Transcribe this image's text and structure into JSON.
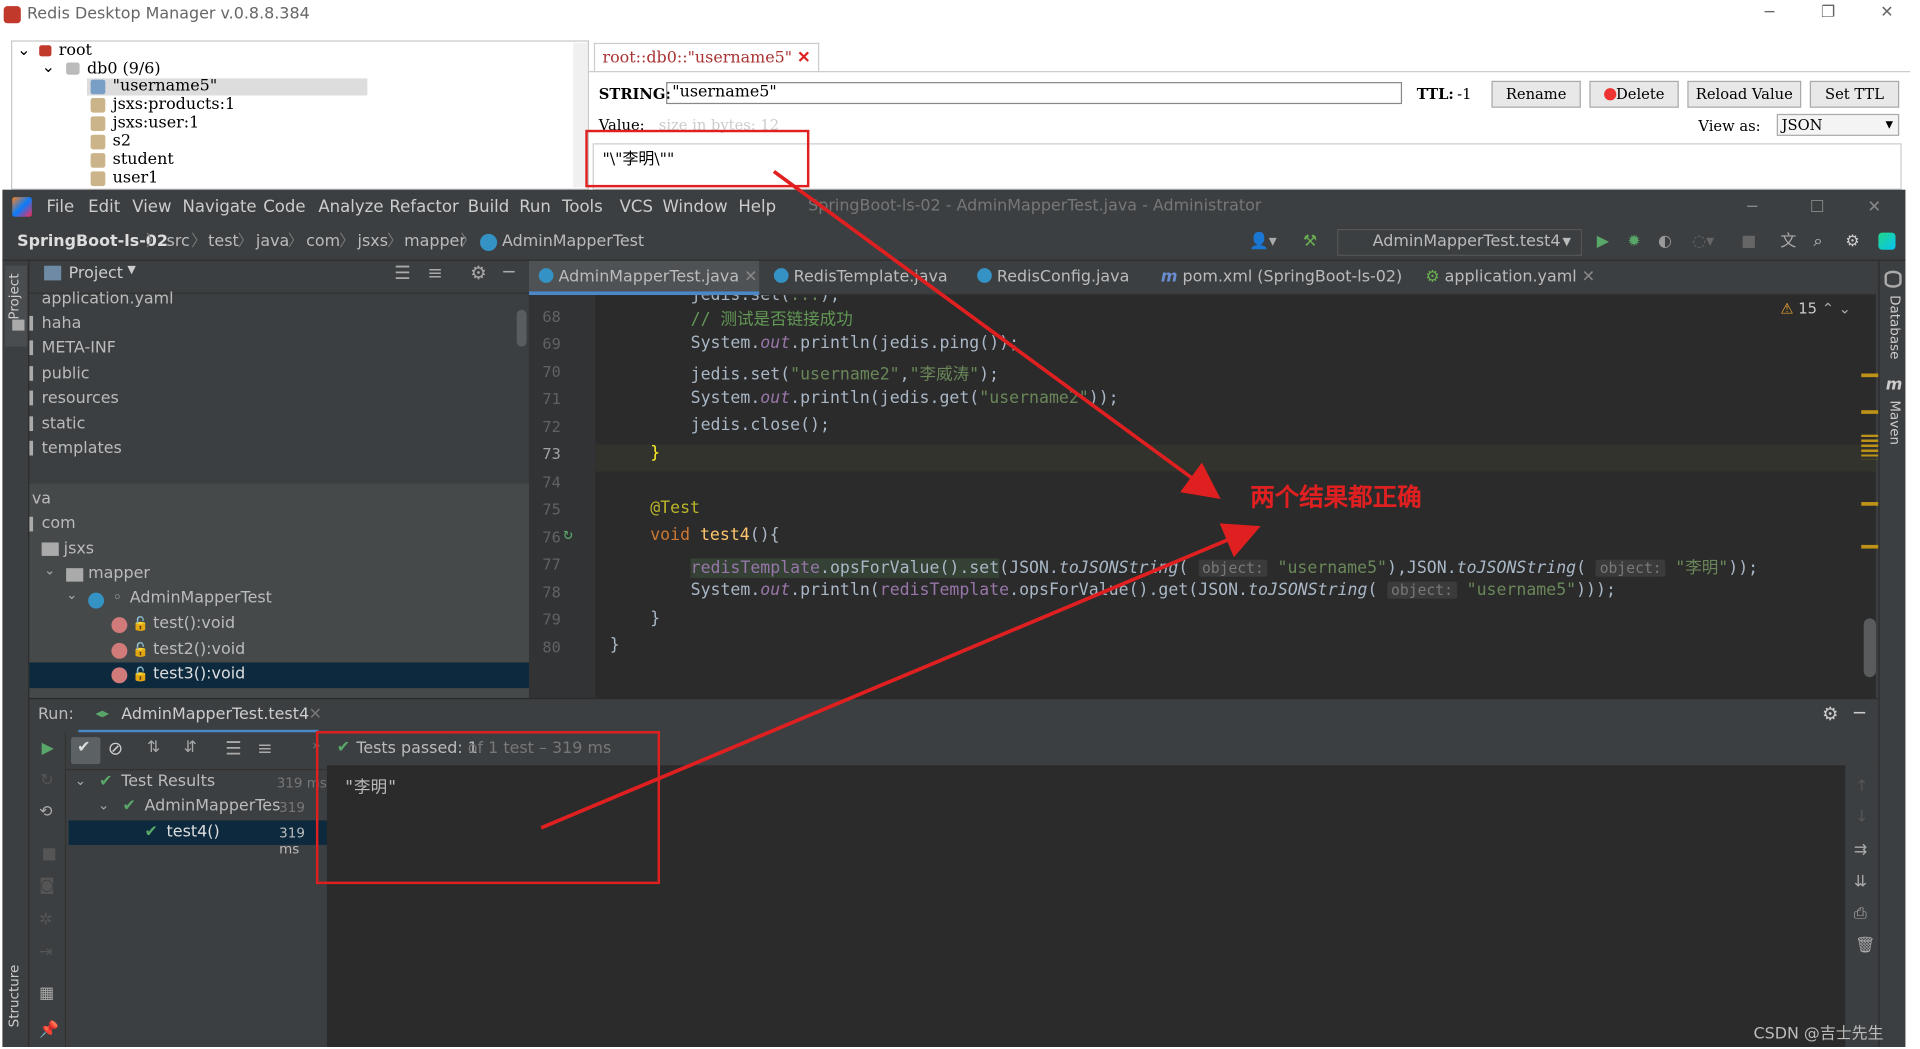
{
  "rdm": {
    "title": "Redis Desktop Manager v.0.8.8.384",
    "tree": {
      "root": "root",
      "db": "db0  (9/6)",
      "keys": [
        "\"username5\"",
        "jsxs:products:1",
        "jsxs:user:1",
        "s2",
        "student",
        "user1"
      ]
    },
    "tab_title": "root::db0::\"username5\"",
    "key_type": "STRING:",
    "key_value": "\"username5\"",
    "ttl_label": "TTL:",
    "ttl_value": "-1",
    "buttons": {
      "rename": "Rename",
      "delete": "Delete",
      "reload": "Reload Value",
      "set_ttl": "Set TTL"
    },
    "value_label": "Value:",
    "value_size": "size in bytes: 12",
    "view_as_label": "View as:",
    "view_as_value": "JSON",
    "value_text": "\"\\\"李明\\\"\""
  },
  "ide": {
    "menu": [
      "File",
      "Edit",
      "View",
      "Navigate",
      "Code",
      "Analyze",
      "Refactor",
      "Build",
      "Run",
      "Tools",
      "VCS",
      "Window",
      "Help"
    ],
    "window_title": "SpringBoot-ls-02 - AdminMapperTest.java - Administrator",
    "breadcrumb": [
      "SpringBoot-ls-02",
      "src",
      "test",
      "java",
      "com",
      "jsxs",
      "mapper",
      "AdminMapperTest"
    ],
    "run_config": "AdminMapperTest.test4",
    "project_label": "Project",
    "project_tree": [
      "application.yaml",
      "haha",
      "META-INF",
      "public",
      "resources",
      "static",
      "templates",
      "va",
      "com",
      "jsxs",
      "mapper",
      "AdminMapperTest",
      "test():void",
      "test2():void",
      "test3():void"
    ],
    "tabs": [
      "AdminMapperTest.java",
      "RedisTemplate.java",
      "RedisConfig.java",
      "pom.xml (SpringBoot-ls-02)",
      "application.yaml"
    ],
    "warnings": "15",
    "line_numbers": [
      "68",
      "69",
      "70",
      "71",
      "72",
      "73",
      "74",
      "75",
      "76",
      "77",
      "78",
      "79",
      "80"
    ],
    "run_label": "Run:",
    "run_tab": "AdminMapperTest.test4",
    "tests_passed": "Tests passed: 1",
    "tests_detail": "of 1 test – 319 ms",
    "test_tree": [
      {
        "label": "Test Results",
        "time": "319 ms"
      },
      {
        "label": "AdminMapperTes",
        "time": "319 ms"
      },
      {
        "label": "test4()",
        "time": "319 ms"
      }
    ],
    "console_output": "\"李明\"",
    "stripe_left": [
      "Project",
      "Structure"
    ],
    "stripe_right": [
      "Database",
      "Maven"
    ]
  },
  "annotation": "两个结果都正确",
  "watermark": "CSDN @吉士先生",
  "colors": {
    "annotation_red": "#e02020",
    "ide_bg": "#2b2b2b"
  }
}
